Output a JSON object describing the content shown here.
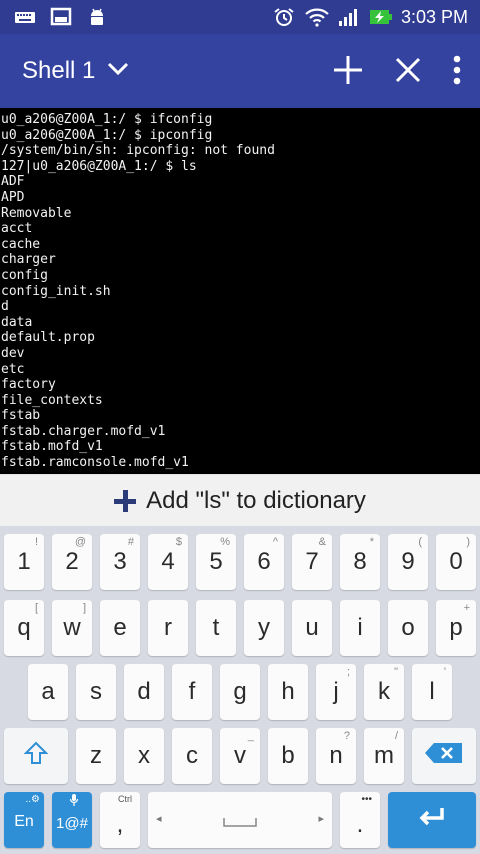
{
  "status_bar": {
    "time": "3:03 PM",
    "left_icons": [
      "keyboard-icon",
      "screen-icon",
      "android-icon"
    ],
    "right_icons": [
      "alarm-icon",
      "wifi-icon",
      "signal-icon",
      "battery-charging-icon"
    ]
  },
  "app_bar": {
    "title": "Shell 1",
    "actions": [
      "add-icon",
      "close-icon",
      "overflow-menu-icon"
    ]
  },
  "terminal": {
    "lines": [
      "u0_a206@Z00A_1:/ $ ifconfig",
      "u0_a206@Z00A_1:/ $ ipconfig",
      "/system/bin/sh: ipconfig: not found",
      "127|u0_a206@Z00A_1:/ $ ls",
      "ADF",
      "APD",
      "Removable",
      "acct",
      "cache",
      "charger",
      "config",
      "config_init.sh",
      "d",
      "data",
      "default.prop",
      "dev",
      "etc",
      "factory",
      "file_contexts",
      "fstab",
      "fstab.charger.mofd_v1",
      "fstab.mofd_v1",
      "fstab.ramconsole.mofd_v1"
    ]
  },
  "suggestion": {
    "text": "Add \"ls\" to dictionary"
  },
  "keyboard": {
    "row_numbers": [
      {
        "label": "1",
        "hint": "!"
      },
      {
        "label": "2",
        "hint": "@"
      },
      {
        "label": "3",
        "hint": "#"
      },
      {
        "label": "4",
        "hint": "$"
      },
      {
        "label": "5",
        "hint": "%"
      },
      {
        "label": "6",
        "hint": "^"
      },
      {
        "label": "7",
        "hint": "&"
      },
      {
        "label": "8",
        "hint": "*"
      },
      {
        "label": "9",
        "hint": "("
      },
      {
        "label": "0",
        "hint": ")"
      }
    ],
    "row_top": [
      {
        "label": "q",
        "hint": "["
      },
      {
        "label": "w",
        "hint": "]"
      },
      {
        "label": "e",
        "hint": ""
      },
      {
        "label": "r",
        "hint": ""
      },
      {
        "label": "t",
        "hint": ""
      },
      {
        "label": "y",
        "hint": ""
      },
      {
        "label": "u",
        "hint": ""
      },
      {
        "label": "i",
        "hint": ""
      },
      {
        "label": "o",
        "hint": ""
      },
      {
        "label": "p",
        "hint": "+"
      }
    ],
    "row_mid": [
      {
        "label": "a",
        "hint": ""
      },
      {
        "label": "s",
        "hint": ""
      },
      {
        "label": "d",
        "hint": ""
      },
      {
        "label": "f",
        "hint": ""
      },
      {
        "label": "g",
        "hint": ""
      },
      {
        "label": "h",
        "hint": ""
      },
      {
        "label": "j",
        "hint": ";"
      },
      {
        "label": "k",
        "hint": "\""
      },
      {
        "label": "l",
        "hint": "'"
      }
    ],
    "row_bottom": [
      {
        "label": "z",
        "hint": ""
      },
      {
        "label": "x",
        "hint": ""
      },
      {
        "label": "c",
        "hint": ""
      },
      {
        "label": "v",
        "hint": "_"
      },
      {
        "label": "b",
        "hint": ""
      },
      {
        "label": "n",
        "hint": "?"
      },
      {
        "label": "m",
        "hint": "/"
      }
    ],
    "lang_key": "En",
    "lang_hint": "..⚙",
    "symbols_key": "1@#",
    "comma_key": ",",
    "comma_hint": "Ctrl",
    "period_key": ".",
    "period_hint": "•••",
    "accent_color": "#2e8fd6"
  }
}
